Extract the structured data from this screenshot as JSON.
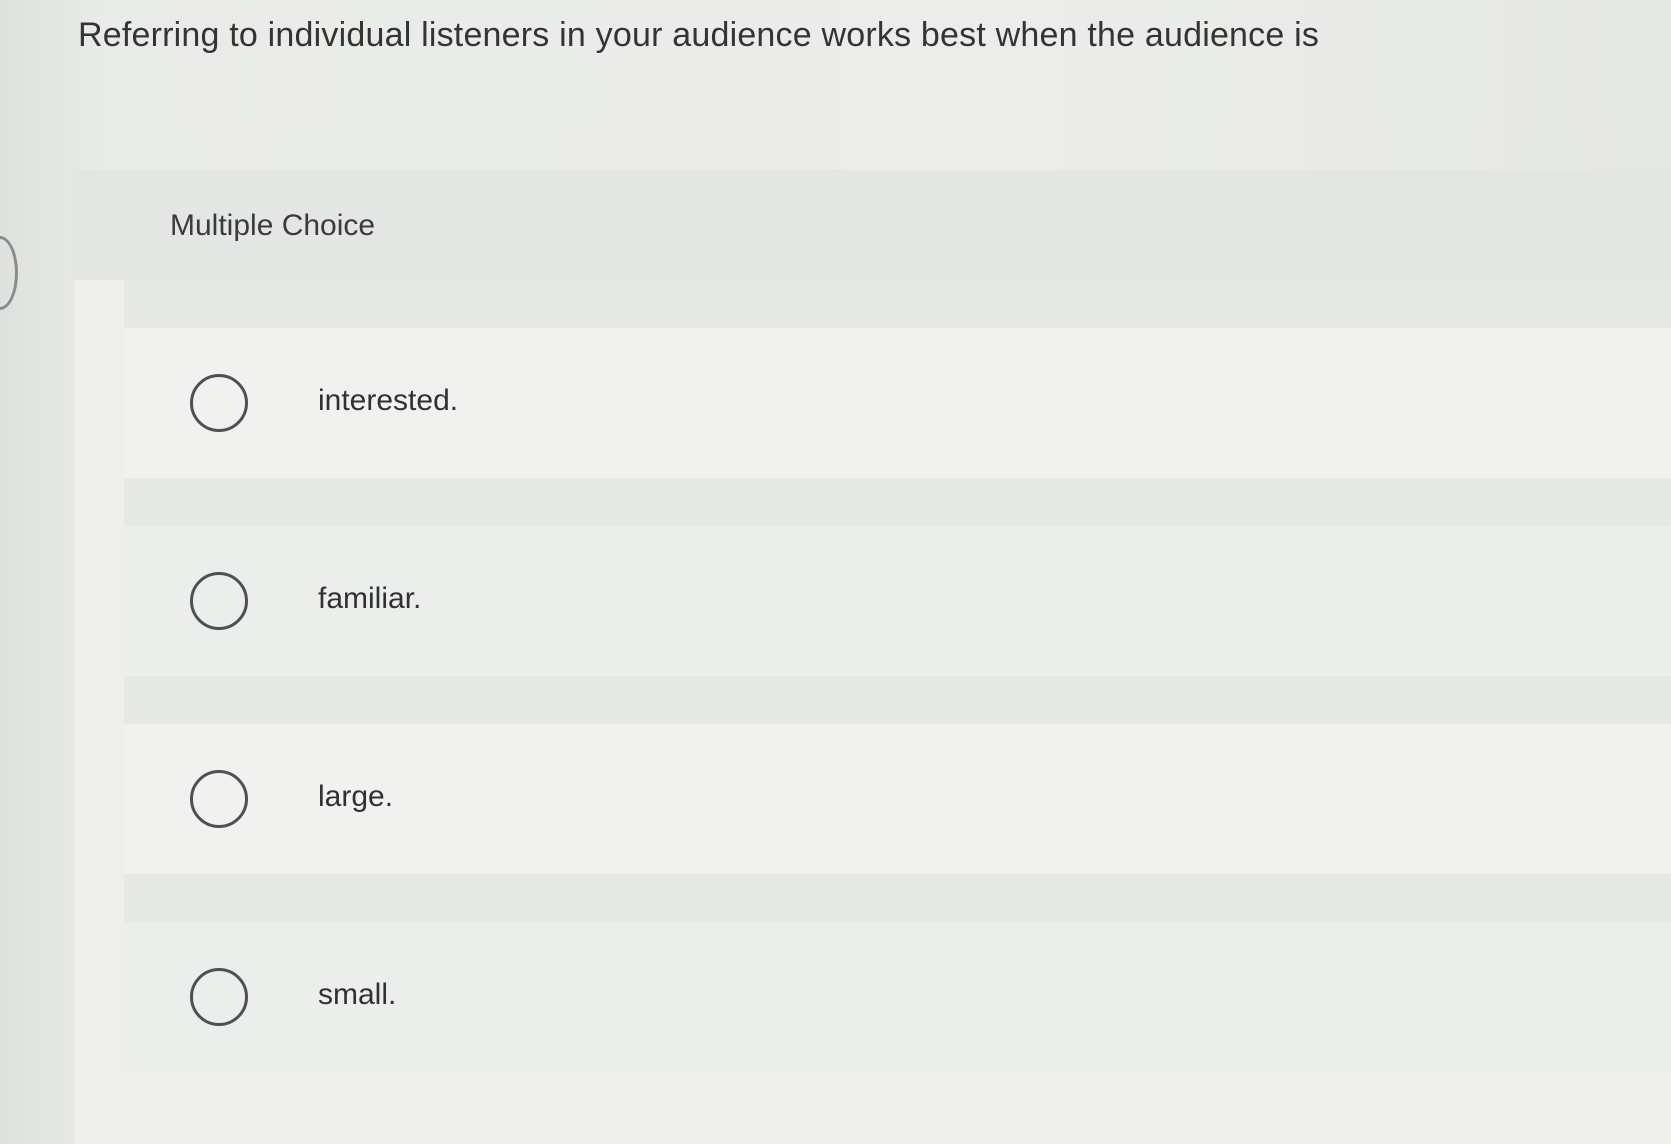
{
  "question": {
    "text": "Referring to individual listeners in your audience works best when the audience is"
  },
  "answer_panel": {
    "type_label": "Multiple Choice",
    "options": [
      {
        "label": "interested."
      },
      {
        "label": "familiar."
      },
      {
        "label": "large."
      },
      {
        "label": "small."
      }
    ]
  }
}
